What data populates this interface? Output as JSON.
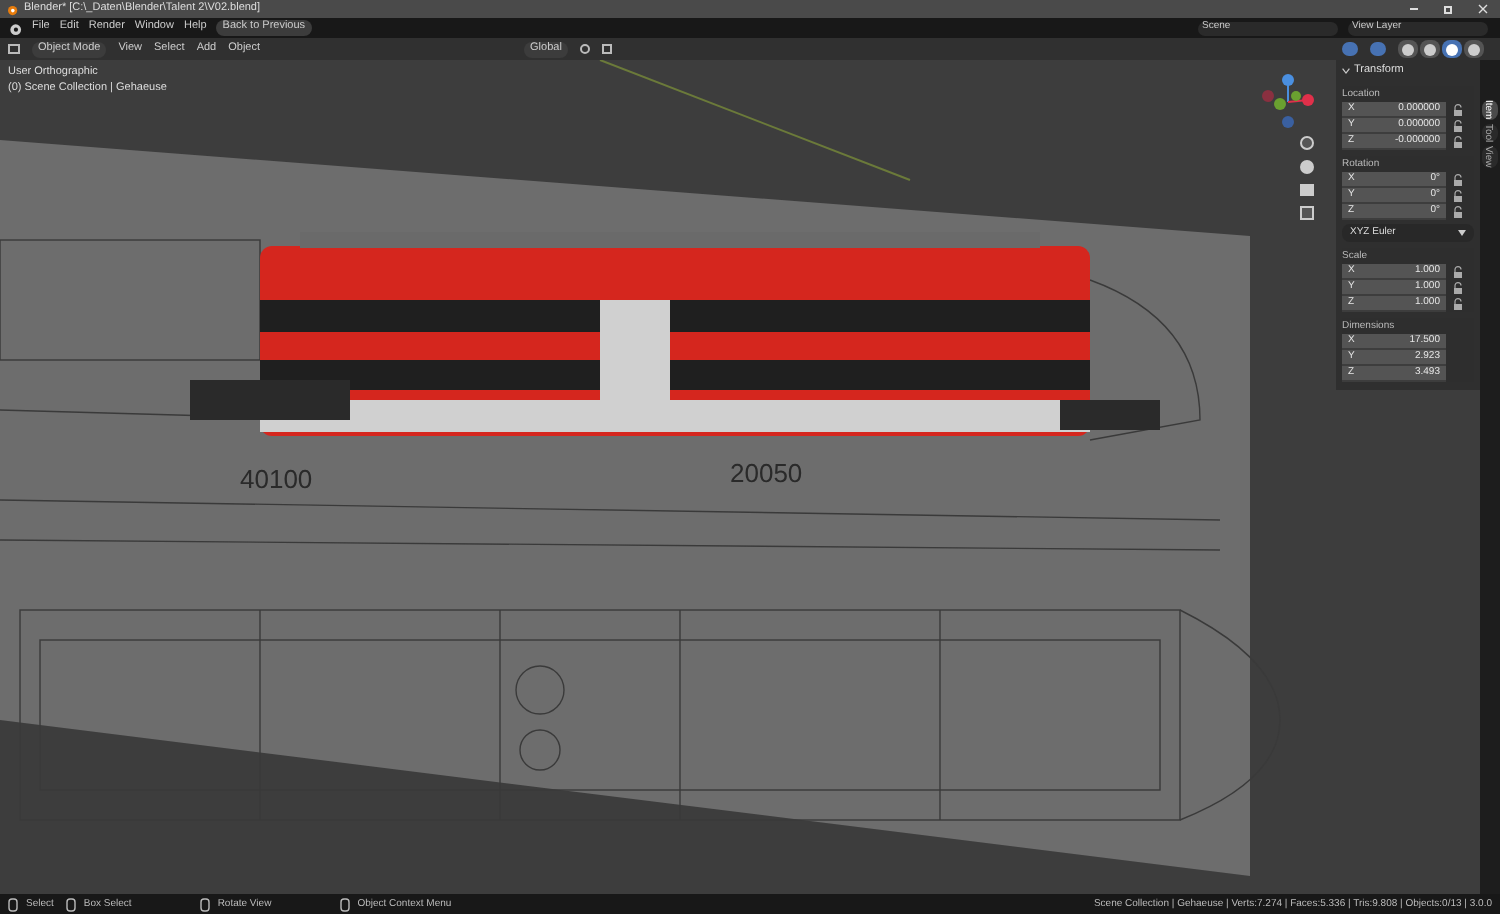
{
  "window": {
    "title": "Blender* [C:\\_Daten\\Blender\\Talent 2\\V02.blend]"
  },
  "menu_bar": {
    "items": [
      "File",
      "Edit",
      "Render",
      "Window",
      "Help"
    ],
    "back_button": "Back to Previous",
    "scene": "Scene",
    "view_layer": "View Layer"
  },
  "header": {
    "mode": "Object Mode",
    "menus": [
      "View",
      "Select",
      "Add",
      "Object"
    ],
    "orientation": "Global",
    "shading": [
      {
        "selected": false
      },
      {
        "selected": false
      },
      {
        "selected": true
      },
      {
        "selected": false
      }
    ]
  },
  "viewport": {
    "view_name": "User Orthographic",
    "collection": "(0) Scene Collection | Gehaeuse",
    "dimension_labels": [
      "40100",
      "20050"
    ]
  },
  "sidebar": {
    "tabs": [
      {
        "label": "Item",
        "selected": true
      },
      {
        "label": "Tool",
        "selected": false
      },
      {
        "label": "View",
        "selected": false
      }
    ],
    "panel_title": "Transform",
    "sections": [
      {
        "kind": "fields",
        "label": "Location",
        "lockable": true,
        "fields": [
          {
            "axis": "X",
            "value": "0.000000"
          },
          {
            "axis": "Y",
            "value": "0.000000"
          },
          {
            "axis": "Z",
            "value": "-0.000000"
          }
        ]
      },
      {
        "kind": "fields",
        "label": "Rotation",
        "lockable": true,
        "fields": [
          {
            "axis": "X",
            "value": "0°"
          },
          {
            "axis": "Y",
            "value": "0°"
          },
          {
            "axis": "Z",
            "value": "0°"
          }
        ]
      },
      {
        "kind": "dropdown",
        "value": "XYZ Euler"
      },
      {
        "kind": "fields",
        "label": "Scale",
        "lockable": true,
        "fields": [
          {
            "axis": "X",
            "value": "1.000"
          },
          {
            "axis": "Y",
            "value": "1.000"
          },
          {
            "axis": "Z",
            "value": "1.000"
          }
        ]
      },
      {
        "kind": "fields",
        "label": "Dimensions",
        "lockable": false,
        "fields": [
          {
            "axis": "X",
            "value": "17.500"
          },
          {
            "axis": "Y",
            "value": "2.923"
          },
          {
            "axis": "Z",
            "value": "3.493"
          }
        ]
      }
    ]
  },
  "status_bar": {
    "hints": [
      "Select",
      "Box Select",
      "Rotate View",
      "Object Context Menu"
    ],
    "stats": "Scene Collection | Gehaeuse | Verts:7.274 | Faces:5.336 | Tris:9.808 | Objects:0/13 | 3.0.0"
  }
}
